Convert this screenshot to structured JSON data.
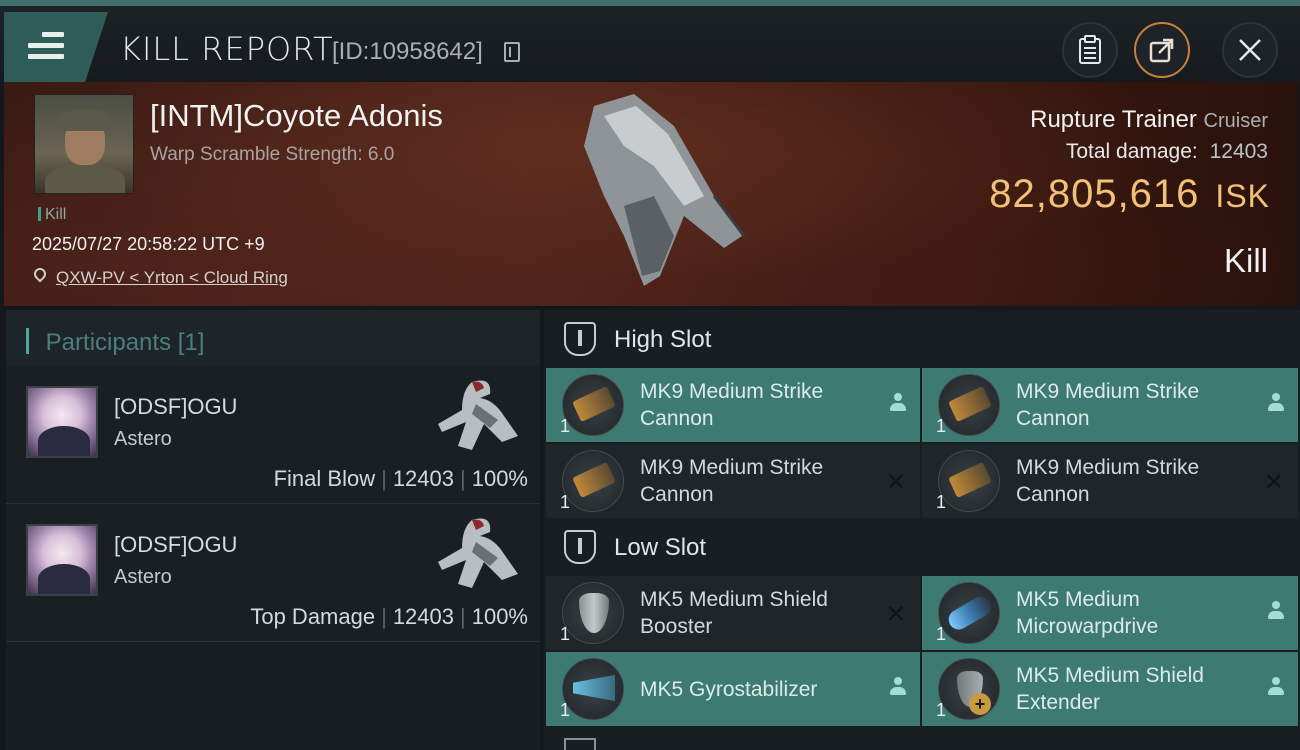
{
  "header": {
    "title": "KILL REPORT",
    "report_id": "[ID:10958642]"
  },
  "victim": {
    "pilot": "[INTM]Coyote Adonis",
    "scramble": "Warp Scramble Strength: 6.0",
    "kill_tag": "Kill",
    "timestamp": "2025/07/27 20:58:22 UTC +9",
    "location": "QXW-PV < Yrton < Cloud Ring",
    "ship_name": "Rupture Trainer",
    "ship_class": "Cruiser",
    "total_damage_label": "Total damage:",
    "total_damage": "12403",
    "isk_value": "82,805,616",
    "isk_unit": "ISK",
    "result": "Kill"
  },
  "participants": {
    "label": "Participants",
    "count": "[1]",
    "rows": [
      {
        "name": "[ODSF]OGU",
        "ship": "Astero",
        "role": "Final Blow",
        "damage": "12403",
        "percent": "100%"
      },
      {
        "name": "[ODSF]OGU",
        "ship": "Astero",
        "role": "Top Damage",
        "damage": "12403",
        "percent": "100%"
      }
    ]
  },
  "fitting": {
    "high_slot_label": "High Slot",
    "low_slot_label": "Low Slot",
    "high": [
      {
        "name": "MK9 Medium Strike Cannon",
        "qty": "1",
        "status": "dropped",
        "icon": "cannon-icon"
      },
      {
        "name": "MK9 Medium Strike Cannon",
        "qty": "1",
        "status": "dropped",
        "icon": "cannon-icon"
      },
      {
        "name": "MK9 Medium Strike Cannon",
        "qty": "1",
        "status": "destroyed",
        "icon": "cannon-icon"
      },
      {
        "name": "MK9 Medium Strike Cannon",
        "qty": "1",
        "status": "destroyed",
        "icon": "cannon-icon"
      }
    ],
    "low": [
      {
        "name": "MK5 Medium Shield Booster",
        "qty": "1",
        "status": "destroyed",
        "icon": "shield-booster-icon"
      },
      {
        "name": "MK5 Medium Microwarpdrive",
        "qty": "1",
        "status": "dropped",
        "icon": "microwarpdrive-icon"
      },
      {
        "name": "MK5 Gyrostabilizer",
        "qty": "1",
        "status": "dropped",
        "icon": "gyrostabilizer-icon"
      },
      {
        "name": "MK5 Medium Shield Extender",
        "qty": "1",
        "status": "dropped",
        "icon": "shield-extender-icon"
      }
    ]
  },
  "colors": {
    "accent": "#3d7a72",
    "isk": "#f2c078",
    "header_tab": "#2e5d57"
  }
}
